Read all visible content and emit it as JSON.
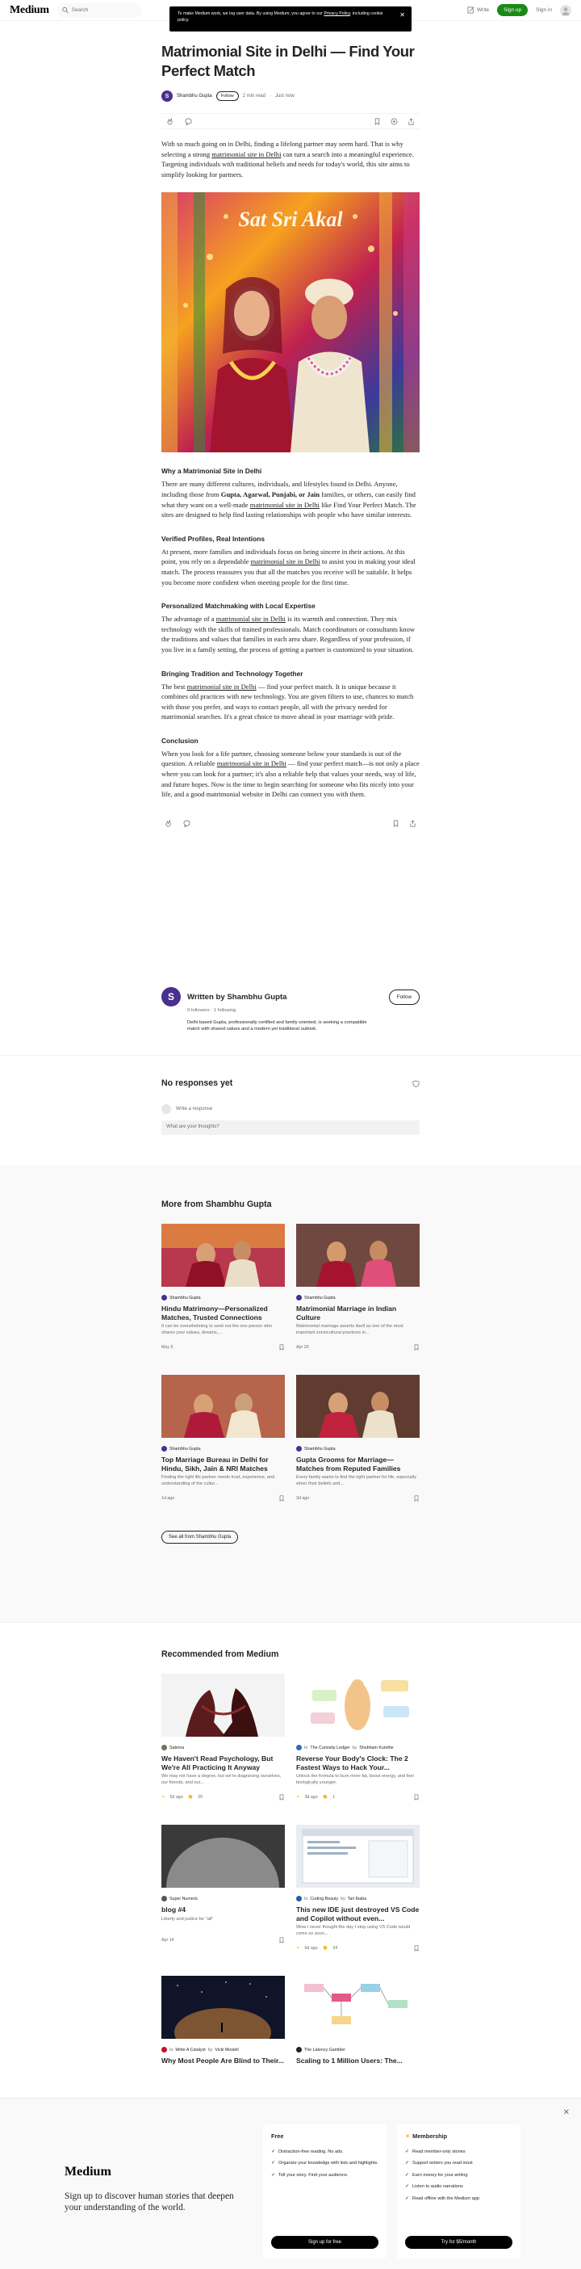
{
  "header": {
    "logo": "Medium",
    "search_placeholder": "Search",
    "write_label": "Write",
    "signup_label": "Sign up",
    "signin_label": "Sign in"
  },
  "cookie": {
    "text_before": "To make Medium work, we log user data. By using Medium, you agree to our ",
    "link": "Privacy Policy",
    "text_after": ", including cookie policy."
  },
  "article": {
    "title": "Matrimonial Site in Delhi — Find Your Perfect Match",
    "author": "Shambhu Gupta",
    "follow_label": "Follow",
    "read_time": "2 min read",
    "separator": "·",
    "published": "Just now",
    "intro_1": "With so much going on in Delhi, finding a lifelong partner may seem hard. That is why selecting a strong ",
    "intro_link": "matrimonial site in Delhi",
    "intro_2": " can turn a search into a meaningful experience. Targeting individuals with traditional beliefs and needs for today's world, this site aims to simplify looking for partners.",
    "hero_text": "Sat Sri Akal",
    "h_why": "Why a Matrimonial Site in Delhi",
    "why_1": "There are many different cultures, individuals, and lifestyles found in Delhi. Anyone, including those from ",
    "why_names": "Gupta, Agarwal, Punjabi, or Jain",
    "why_2": " families, or others, can easily find what they want on a well-made ",
    "why_link": "matrimonial site in Delhi",
    "why_3": " like Find Your Perfect Match. The sites are designed to help find lasting relationships with people who have similar interests.",
    "h_verified": "Verified Profiles, Real Intentions",
    "ver_1": "At present, more families and individuals focus on being sincere in their actions. At this point, you rely on a dependable ",
    "ver_link": "matrimonial site in Delhi",
    "ver_2": " to assist you in making your ideal match. The process reassures you that all the matches you receive will be suitable. It helps you become more confident when meeting people for the first time.",
    "h_personal": "Personalized Matchmaking with Local Expertise",
    "per_1": "The advantage of a ",
    "per_link": "matrimonial site in Delhi",
    "per_2": " is its warmth and connection. They mix technology with the skills of trained professionals. Match coordinators or consultants know the traditions and values that families in each area share. Regardless of your profession, if you live in a family setting, the process of getting a partner is customized to your situation.",
    "h_bridging": "Bringing Tradition and Technology Together",
    "bri_1": "The best ",
    "bri_link": "matrimonial site in Delhi",
    "bri_2": " — find your perfect match. It is unique because it combines old practices with new technology. You are given filters to use, chances to match with those you prefer, and ways to contact people, all with the privacy needed for matrimonial searches. It's a great choice to move ahead in your marriage with pride.",
    "h_conclusion": "Conclusion",
    "con_1": "When you look for a life partner, choosing someone below your standards is out of the question. A reliable ",
    "con_link": "matrimonial site in Delhi",
    "con_2": " — find your perfect match—is not only a place where you can look for a partner; it's also a reliable help that values your needs, way of life, and future hopes. Now is the time to begin searching for someone who fits nicely into your life, and a good matrimonial website in Delhi can connect you with them."
  },
  "written_by": {
    "initial": "S",
    "label": "Written by Shambhu Gupta",
    "followers": "0 followers",
    "following": "1 following",
    "bio": "Delhi based Gupta, professionally certified and family oriented, is seeking a compatible match with shared values and a modern yet traditional outlook.",
    "follow_label": "Follow"
  },
  "responses": {
    "title": "No responses yet",
    "user_placeholder": "Write a response",
    "input_placeholder": "What are your thoughts?"
  },
  "more_from": {
    "title": "More from Shambhu Gupta",
    "see_all": "See all from Shambhu Gupta",
    "cards": [
      {
        "author": "Shambhu Gupta",
        "title": "Hindu Matrimony—Personalized Matches, Trusted Connections",
        "sub": "It can be overwhelming to seek out the one person who shares your values, dreams,...",
        "date": "May 5"
      },
      {
        "author": "Shambhu Gupta",
        "title": "Matrimonial Marriage in Indian Culture",
        "sub": "Matrimonial marriage asserts itself as one of the most important sociocultural practices in...",
        "date": "Apr 29"
      },
      {
        "author": "Shambhu Gupta",
        "title": "Top Marriage Bureau in Delhi for Hindu, Sikh, Jain & NRI Matches",
        "sub": "Finding the right life partner needs trust, experience, and understanding of the cultur...",
        "date": "1d ago"
      },
      {
        "author": "Shambhu Gupta",
        "title": "Gupta Grooms for Marriage—Matches from Reputed Families",
        "sub": "Every family wants to find the right partner for life, especially when their beliefs and...",
        "date": "3d ago"
      }
    ]
  },
  "recommended": {
    "title": "Recommended from Medium",
    "cards": [
      {
        "pub": "",
        "author": "Sabrina",
        "title": "We Haven't Read Psychology, But We're All Practicing It Anyway",
        "sub": "We may not have a degree, but we're diagnosing ourselves, our friends, and our...",
        "date": "5d ago",
        "claps": "25"
      },
      {
        "pub": "The Curiosity Ledger",
        "author": "Shubham Kumthe",
        "title": "Reverse Your Body's Clock: The 2 Fastest Ways to Hack Your...",
        "sub": "Unlock the formula to burn more fat, boost energy, and feel biologically younger.",
        "date": "3d ago",
        "claps": "1"
      },
      {
        "pub": "",
        "author": "Super Numeric",
        "title": "blog #4",
        "sub": "Liberty and justice for \"all\"",
        "date": "Apr 14",
        "claps": ""
      },
      {
        "pub": "Coding Beauty",
        "author": "Tari Ibaba",
        "title": "This new IDE just destroyed VS Code and Copilot without even...",
        "sub": "Wow I never thought the day I stop using VS Code would come so soon...",
        "date": "6d ago",
        "claps": "34"
      },
      {
        "pub": "Write A Catalyst",
        "author": "Vicki Mostell",
        "title": "Why Most People Are Blind to Their...",
        "sub": "",
        "date": "",
        "claps": ""
      },
      {
        "pub": "",
        "author": "The Latency Gambler",
        "title": "Scaling to 1 Million Users: The...",
        "sub": "",
        "date": "",
        "claps": ""
      }
    ]
  },
  "overlay": {
    "logo": "Medium",
    "tagline": "Sign up to discover human stories that deepen your understanding of the world.",
    "free": {
      "title": "Free",
      "items": [
        "Distraction-free reading. No ads.",
        "Organize your knowledge with lists and highlights.",
        "Tell your story. Find your audience."
      ],
      "button": "Sign up for free"
    },
    "member": {
      "title": "Membership",
      "items": [
        "Read member-only stories",
        "Support writers you read most",
        "Earn money for your writing",
        "Listen to audio narrations",
        "Read offline with the Medium app"
      ],
      "button": "Try for $5/month"
    }
  },
  "colors": {
    "accent": "#1a8917",
    "text": "#242424",
    "muted": "#6b6b6b"
  }
}
